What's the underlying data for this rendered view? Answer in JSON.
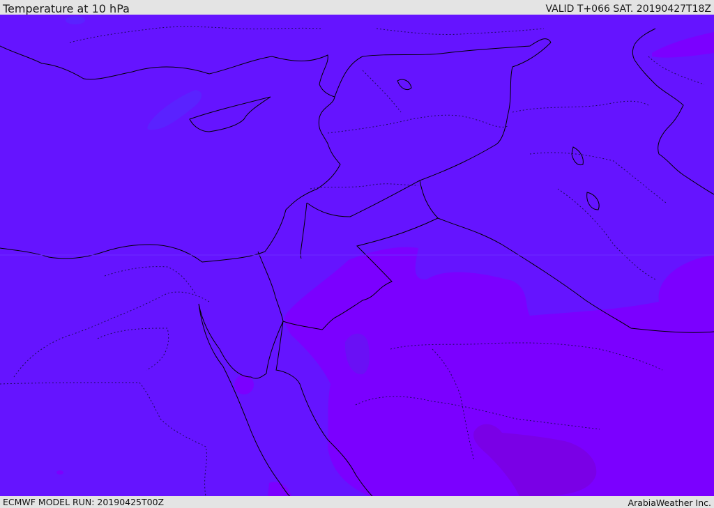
{
  "header": {
    "title": "Temperature at 10 hPa",
    "valid_time": "VALID T+066 SAT. 20190427T18Z"
  },
  "footer": {
    "model_run": "ECMWF MODEL RUN: 20190425T00Z",
    "credit": "ArabiaWeather Inc."
  },
  "map": {
    "colors": {
      "base_field": "#6514ff",
      "warm_field": "#7b00ff",
      "warmer_field": "#7a00e6",
      "cool_patch": "#5a22ff",
      "coast_line": "#000000",
      "border_line": "#000000"
    }
  }
}
